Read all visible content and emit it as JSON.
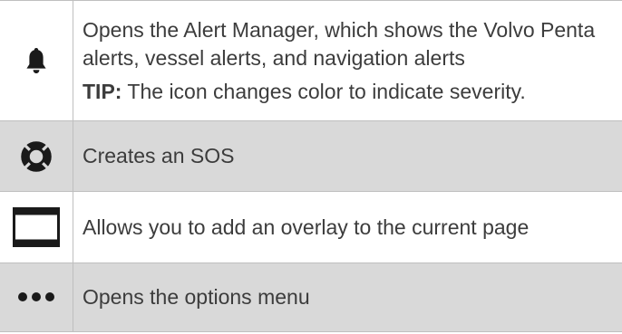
{
  "rows": [
    {
      "icon": "bell-icon",
      "description": "Opens the Alert Manager, which shows the Volvo Penta alerts, vessel alerts, and navigation alerts",
      "tip_label": "TIP:",
      "tip_text": " The icon changes color to indicate severity."
    },
    {
      "icon": "lifebuoy-icon",
      "description": "Creates an SOS"
    },
    {
      "icon": "overlay-icon",
      "description": "Allows you to add an overlay to the current page"
    },
    {
      "icon": "more-options-icon",
      "description": "Opens the options menu"
    }
  ],
  "colors": {
    "shaded_row": "#d9d9d9",
    "border": "#bfbfbf",
    "text": "#3c3c3c",
    "icon": "#1a1a1a"
  }
}
